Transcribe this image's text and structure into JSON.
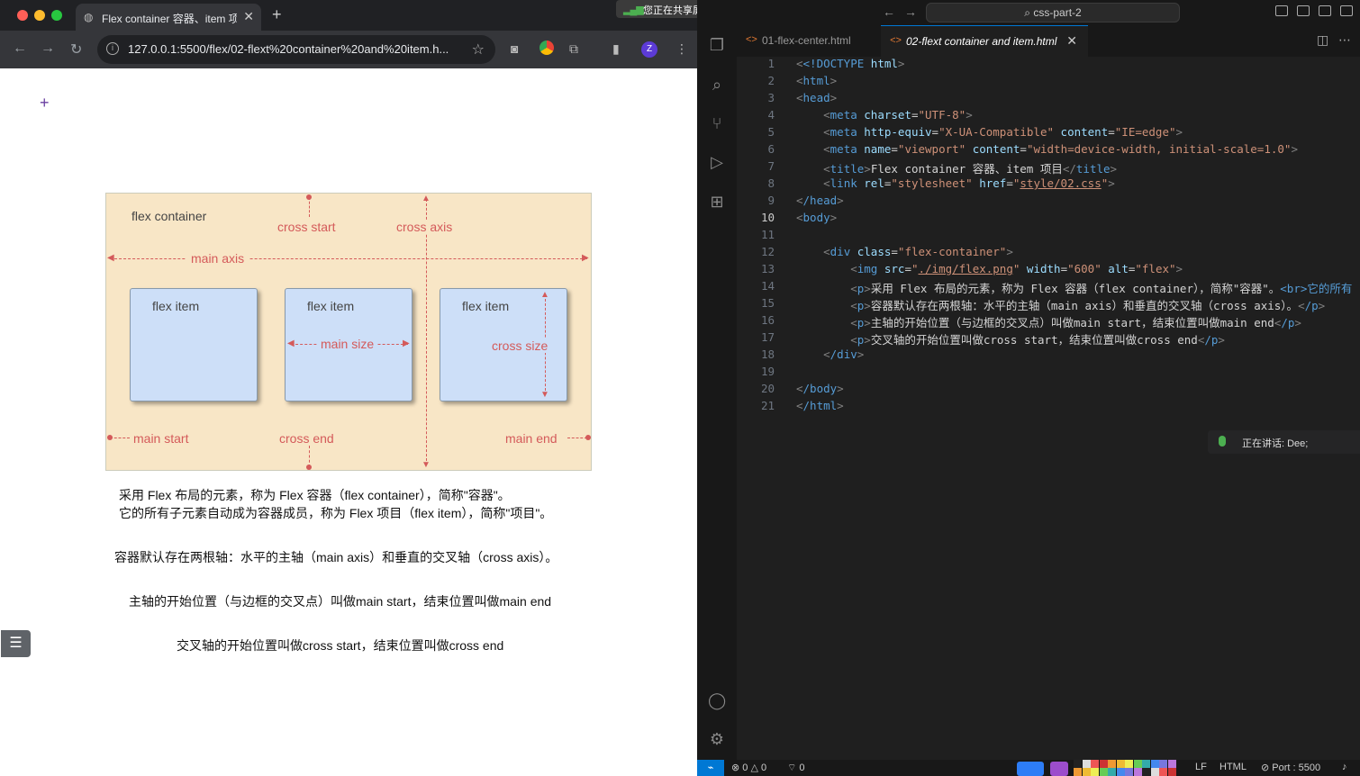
{
  "browser": {
    "tab_title": "Flex container 容器、item 项目",
    "url": "127.0.0.1:5500/flex/02-flext%20container%20and%20item.h...",
    "share_banner": "您正在共享屏幕",
    "avatar_letter": "Z"
  },
  "figure": {
    "container_label": "flex container",
    "cross_start": "cross start",
    "cross_axis": "cross axis",
    "main_axis": "main axis",
    "item_label": "flex item",
    "main_size": "main size",
    "cross_size": "cross size",
    "main_start": "main start",
    "cross_end": "cross end",
    "main_end": "main end"
  },
  "paragraphs": [
    "采用 Flex 布局的元素，称为 Flex 容器（flex container），简称\"容器\"。",
    "它的所有子元素自动成为容器成员，称为 Flex 项目（flex item），简称\"项目\"。",
    "容器默认存在两根轴：水平的主轴（main axis）和垂直的交叉轴（cross axis）。",
    "主轴的开始位置（与边框的交叉点）叫做main start，结束位置叫做main end",
    "交叉轴的开始位置叫做cross start，结束位置叫做cross end"
  ],
  "vscode": {
    "search_text": "css-part-2",
    "tabs": [
      "01-flex-center.html",
      "02-flext container and item.html"
    ],
    "line_numbers": [
      "1",
      "2",
      "3",
      "4",
      "5",
      "6",
      "7",
      "8",
      "9",
      "10",
      "11",
      "12",
      "13",
      "14",
      "15",
      "16",
      "17",
      "18",
      "19",
      "20",
      "21"
    ],
    "current_line": "10",
    "talking": "正在讲话:  Dee;",
    "status": {
      "errors": "0",
      "warnings": "0",
      "ports_count": "0",
      "eol": "LF",
      "language": "HTML",
      "port": "Port : 5500"
    }
  },
  "code": {
    "l1_a": "<!DOCTYPE",
    "l1_b": " html",
    "l1_c": ">",
    "l2": "html",
    "l3": "head",
    "l4_tag": "meta",
    "l4_attr": "charset",
    "l4_val": "\"UTF-8\"",
    "l5_tag": "meta",
    "l5_attr1": "http-equiv",
    "l5_val1": "\"X-UA-Compatible\"",
    "l5_attr2": "content",
    "l5_val2": "\"IE=edge\"",
    "l6_tag": "meta",
    "l6_attr1": "name",
    "l6_val1": "\"viewport\"",
    "l6_attr2": "content",
    "l6_val2": "\"width=device-width, initial-scale=1.0\"",
    "l7_tag": "title",
    "l7_text": "Flex container 容器、item 项目",
    "l8_tag": "link",
    "l8_attr1": "rel",
    "l8_val1": "\"stylesheet\"",
    "l8_attr2": "href",
    "l8_val2a": "\"",
    "l8_val2b": "style/02.css",
    "l8_val2c": "\"",
    "l9": "/head",
    "l10": "body",
    "l12_tag": "div",
    "l12_attr": "class",
    "l12_val": "\"flex-container\"",
    "l13_tag": "img",
    "l13_attr1": "src",
    "l13_val1a": "\"",
    "l13_val1b": "./img/flex.png",
    "l13_val1c": "\"",
    "l13_attr2": "width",
    "l13_val2": "\"600\"",
    "l13_attr3": "alt",
    "l13_val3": "\"flex\"",
    "l14_text": "采用 Flex 布局的元素，称为 Flex 容器（flex container），简称\"容器\"。",
    "l14_tail": "<br>它的所有",
    "l15_text": "容器默认存在两根轴：水平的主轴（main axis）和垂直的交叉轴（cross axis）。",
    "l16_text": "主轴的开始位置（与边框的交叉点）叫做main start，结束位置叫做main end",
    "l17_text": "交叉轴的开始位置叫做cross start，结束位置叫做cross end",
    "l18": "/div",
    "l20": "/body",
    "l21": "/html",
    "p": "p",
    "p_close": "/p"
  }
}
